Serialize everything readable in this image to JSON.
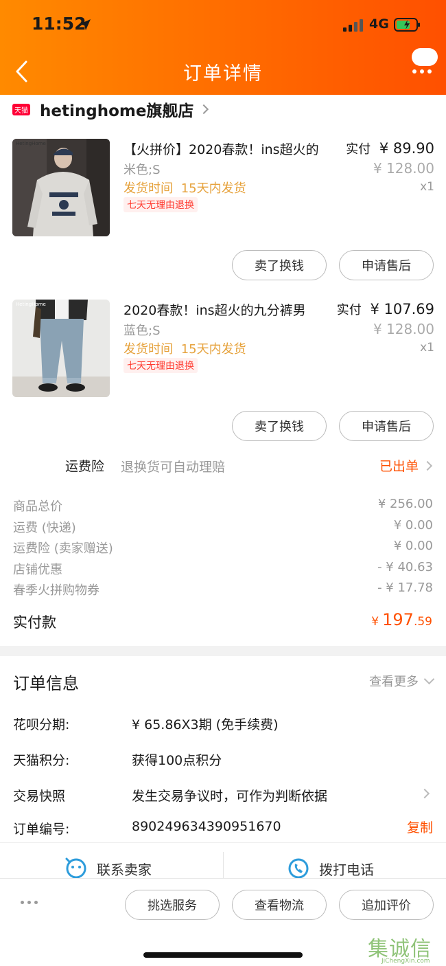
{
  "status_bar": {
    "time": "11:52",
    "network": "4G"
  },
  "header": {
    "title": "订单详情"
  },
  "shop": {
    "badge": "天猫",
    "name": "hetinghome旗舰店"
  },
  "products": [
    {
      "brand_mark": "HetingHome",
      "name": "【火拼价】2020春款！ins超火的",
      "spec": "米色;S",
      "ship_label": "发货时间",
      "ship_value": "15天内发货",
      "tag": "七天无理由退换",
      "paid_label": "实付",
      "paid_price": "¥ 89.90",
      "original_price": "¥ 128.00",
      "qty": "x1",
      "btn_sell": "卖了换钱",
      "btn_aftersale": "申请售后"
    },
    {
      "brand_mark": "HetingHome",
      "name": "2020春款！ins超火的九分裤男",
      "spec": "蓝色;S",
      "ship_label": "发货时间",
      "ship_value": "15天内发货",
      "tag": "七天无理由退换",
      "paid_label": "实付",
      "paid_price": "¥ 107.69",
      "original_price": "¥ 128.00",
      "qty": "x1",
      "btn_sell": "卖了换钱",
      "btn_aftersale": "申请售后"
    }
  ],
  "insurance": {
    "label": "运费险",
    "desc": "退换货可自动理赔",
    "status": "已出单"
  },
  "summary": [
    {
      "label": "商品总价",
      "value": "¥ 256.00"
    },
    {
      "label": "运费 (快递)",
      "value": "¥ 0.00"
    },
    {
      "label": "运费险 (卖家赠送)",
      "value": "¥ 0.00"
    },
    {
      "label": "店铺优惠",
      "value": "- ¥ 40.63"
    },
    {
      "label": "春季火拼购物券",
      "value": "- ¥ 17.78"
    }
  ],
  "payment": {
    "label": "实付款",
    "currency": "¥",
    "int_part": "197",
    "dec_part": ".59"
  },
  "order_info": {
    "title": "订单信息",
    "more": "查看更多",
    "rows": [
      {
        "key": "花呗分期:",
        "value": "¥ 65.86X3期 (免手续费)"
      },
      {
        "key": "天猫积分:",
        "value": "获得100点积分"
      },
      {
        "key": "交易快照",
        "value": "发生交易争议时，可作为判断依据"
      },
      {
        "key": "订单编号:",
        "value": "890249634390951670"
      }
    ],
    "copy": "复制"
  },
  "contact": {
    "seller": "联系卖家",
    "phone": "拨打电话"
  },
  "bottom_bar": {
    "btn1": "挑选服务",
    "btn2": "查看物流",
    "btn3": "追加评价"
  },
  "watermark": {
    "text": "集诚信",
    "url": "JiChengXin.com"
  },
  "colors": {
    "accent": "#ff5000",
    "header_start": "#ff8a00",
    "ship": "#e6a23c",
    "tag": "#ff3b30",
    "contact_icon": "#2d9cdb"
  }
}
